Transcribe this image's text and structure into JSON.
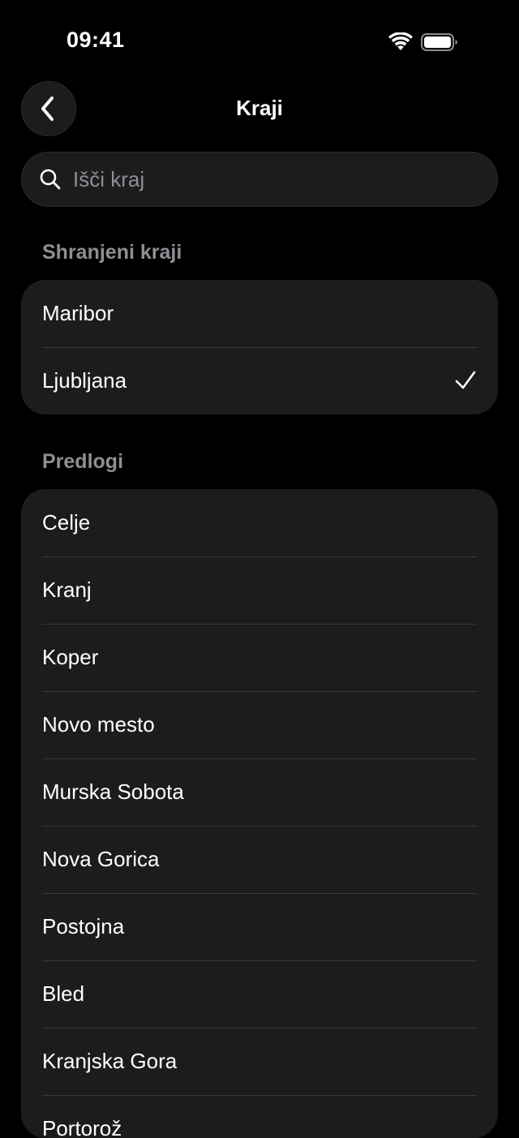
{
  "status_bar": {
    "time": "09:41",
    "icons": [
      "wifi-icon",
      "battery-icon"
    ]
  },
  "nav": {
    "title": "Kraji",
    "back_icon": "chevron-left-icon"
  },
  "search": {
    "placeholder": "Išči kraj",
    "value": "",
    "icon": "search-icon"
  },
  "saved": {
    "header": "Shranjeni kraji",
    "items": [
      {
        "label": "Maribor",
        "selected": false
      },
      {
        "label": "Ljubljana",
        "selected": true,
        "icon": "checkmark-icon"
      }
    ]
  },
  "suggestions": {
    "header": "Predlogi",
    "items": [
      {
        "label": "Celje"
      },
      {
        "label": "Kranj"
      },
      {
        "label": "Koper"
      },
      {
        "label": "Novo mesto"
      },
      {
        "label": "Murska Sobota"
      },
      {
        "label": "Nova Gorica"
      },
      {
        "label": "Postojna"
      },
      {
        "label": "Bled"
      },
      {
        "label": "Kranjska Gora"
      },
      {
        "label": "Portorož"
      }
    ]
  },
  "colors": {
    "background": "#000000",
    "card": "#1c1c1e",
    "separator": "#38383a",
    "secondary_text": "#8e8e93",
    "primary_text": "#ffffff"
  }
}
